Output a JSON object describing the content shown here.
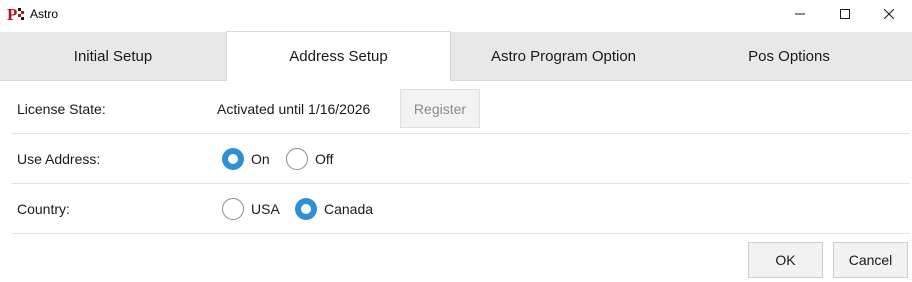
{
  "window": {
    "title": "Astro",
    "app_icon": "astro-app-icon",
    "accent_color": "#2f8fd6"
  },
  "tabs": [
    {
      "label": "Initial Setup",
      "active": false
    },
    {
      "label": "Address Setup",
      "active": true
    },
    {
      "label": "Astro Program Option",
      "active": false
    },
    {
      "label": "Pos Options",
      "active": false
    }
  ],
  "license": {
    "label": "License State:",
    "value": "Activated until 1/16/2026",
    "register_label": "Register",
    "register_enabled": false
  },
  "use_address": {
    "label": "Use Address:",
    "options": [
      {
        "label": "On",
        "checked": true
      },
      {
        "label": "Off",
        "checked": false
      }
    ]
  },
  "country": {
    "label": "Country:",
    "options": [
      {
        "label": "USA",
        "checked": false
      },
      {
        "label": "Canada",
        "checked": true
      }
    ]
  },
  "footer": {
    "ok_label": "OK",
    "cancel_label": "Cancel"
  }
}
